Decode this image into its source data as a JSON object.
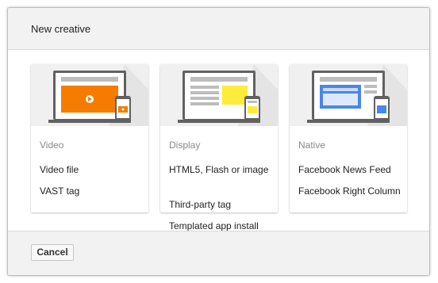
{
  "dialog": {
    "title": "New creative",
    "cancel_label": "Cancel"
  },
  "cards": [
    {
      "category": "Video",
      "options": [
        "Video file",
        "VAST tag"
      ],
      "accent": "#f57c00"
    },
    {
      "category": "Display",
      "options": [
        "HTML5, Flash or image",
        "Third-party tag",
        "Templated app install"
      ],
      "accent": "#ffeb3b"
    },
    {
      "category": "Native",
      "options": [
        "Facebook News Feed",
        "Facebook Right Column"
      ],
      "accent": "#4a86e8"
    }
  ]
}
